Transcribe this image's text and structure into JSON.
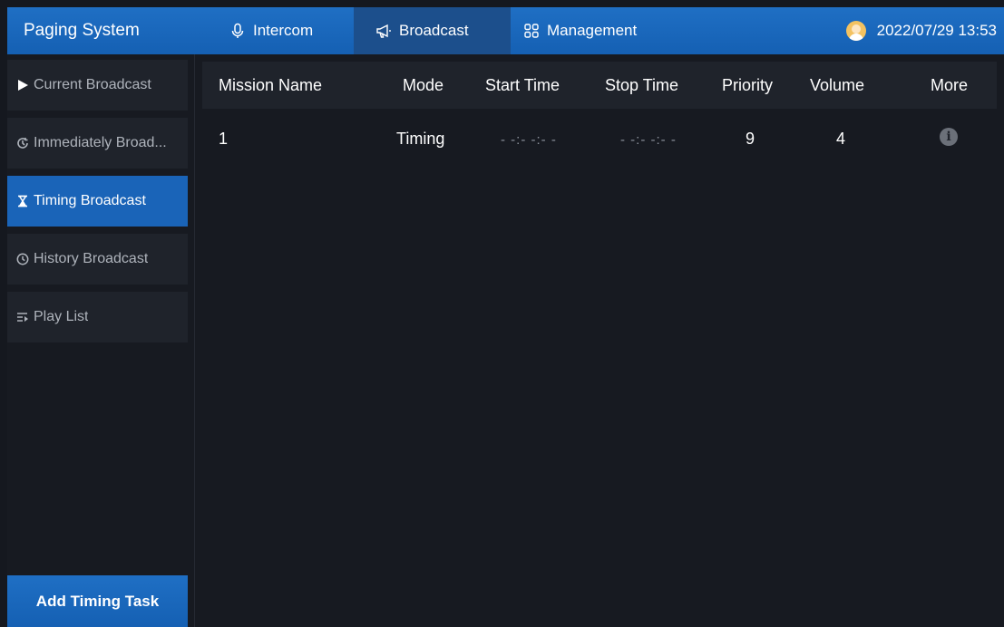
{
  "header": {
    "app_title": "Paging System",
    "tabs": [
      {
        "label": "Intercom",
        "icon": "microphone-icon"
      },
      {
        "label": "Broadcast",
        "icon": "megaphone-icon",
        "active": true
      },
      {
        "label": "Management",
        "icon": "grid-icon"
      }
    ],
    "datetime": "2022/07/29 13:53",
    "accent_color": "#1a64b8"
  },
  "sidebar": {
    "items": [
      {
        "label": "Current Broadcast",
        "icon": "play-icon"
      },
      {
        "label": "Immediately Broad...",
        "icon": "refresh-clock-icon"
      },
      {
        "label": "Timing Broadcast",
        "icon": "hourglass-icon",
        "active": true
      },
      {
        "label": "History Broadcast",
        "icon": "clock-icon"
      },
      {
        "label": "Play List",
        "icon": "playlist-icon"
      }
    ],
    "add_button": "Add Timing Task"
  },
  "table": {
    "columns": [
      "Mission Name",
      "Mode",
      "Start Time",
      "Stop Time",
      "Priority",
      "Volume",
      "More"
    ],
    "rows": [
      {
        "mission_name": "1",
        "mode": "Timing",
        "start_time": "- -:- -:- -",
        "stop_time": "- -:- -:- -",
        "priority": "9",
        "volume": "4",
        "more_icon": "info-icon"
      }
    ]
  }
}
